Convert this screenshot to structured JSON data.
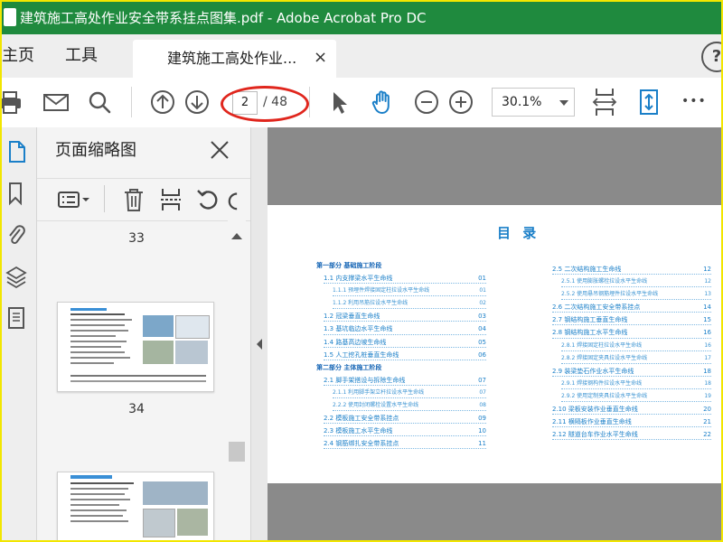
{
  "window": {
    "title": "建筑施工高处作业安全带系挂点图集.pdf - Adobe Acrobat Pro DC"
  },
  "menu": {
    "home": "主页",
    "tools": "工具"
  },
  "tab": {
    "label": "建筑施工高处作业...",
    "close": "×"
  },
  "help": "?",
  "toolbar": {
    "current_page": "2",
    "total_pages": "/ 48",
    "zoom": "30.1%",
    "more": "•••"
  },
  "panel": {
    "title": "页面缩略图",
    "thumbnails": [
      {
        "page": "33"
      },
      {
        "page": "34"
      }
    ]
  },
  "colors": {
    "titlebar": "#1f8a3e",
    "accent_blue": "#1a7fc8",
    "annotation_red": "#e0261d"
  },
  "document": {
    "toc_title": "目  录",
    "left_column": [
      {
        "title": "第一部分 基础施工阶段",
        "page": "",
        "level": "part"
      },
      {
        "title": "1.1 内支撑梁水平生命线",
        "page": "01",
        "level": "item"
      },
      {
        "title": "1.1.1 预埋件焊接固定柱拉设水平生命线",
        "page": "01",
        "level": "sub"
      },
      {
        "title": "1.1.2 利用吊筋拉设水平生命线",
        "page": "02",
        "level": "sub"
      },
      {
        "title": "1.2 冠梁垂直生命线",
        "page": "03",
        "level": "item"
      },
      {
        "title": "1.3 基坑临边水平生命线",
        "page": "04",
        "level": "item"
      },
      {
        "title": "1.4 路基高边坡生命线",
        "page": "05",
        "level": "item"
      },
      {
        "title": "1.5 人工挖孔桩垂直生命线",
        "page": "06",
        "level": "item"
      },
      {
        "title": "第二部分 主体施工阶段",
        "page": "",
        "level": "part"
      },
      {
        "title": "2.1 脚手架搭设与拆除生命线",
        "page": "07",
        "level": "item"
      },
      {
        "title": "2.1.1 利用脚手架立杆拉设水平生命线",
        "page": "07",
        "level": "sub"
      },
      {
        "title": "2.2.2 使用封闭螺栓设置水平生命线",
        "page": "08",
        "level": "sub"
      },
      {
        "title": "2.2 模板施工安全带系挂点",
        "page": "09",
        "level": "item"
      },
      {
        "title": "2.3 模板施工水平生命线",
        "page": "10",
        "level": "item"
      },
      {
        "title": "2.4 钢筋绑扎安全带系挂点",
        "page": "11",
        "level": "item"
      }
    ],
    "right_column": [
      {
        "title": "2.5 二次结构施工生命线",
        "page": "12",
        "level": "item"
      },
      {
        "title": "2.5.1 使用膨胀螺栓拉设水平生命线",
        "page": "12",
        "level": "sub"
      },
      {
        "title": "2.5.2 使用悬吊钢筋埋件拉设水平生命线",
        "page": "13",
        "level": "sub"
      },
      {
        "title": "2.6 二次结构施工安全带系挂点",
        "page": "14",
        "level": "item"
      },
      {
        "title": "2.7 钢结构施工垂直生命线",
        "page": "15",
        "level": "item"
      },
      {
        "title": "2.8 钢结构施工水平生命线",
        "page": "16",
        "level": "item"
      },
      {
        "title": "2.8.1 焊接固定柱拉设水平生命线",
        "page": "16",
        "level": "sub"
      },
      {
        "title": "2.8.2 焊接固定夹具拉设水平生命线",
        "page": "17",
        "level": "sub"
      },
      {
        "title": "2.9 装梁垫石作业水平生命线",
        "page": "18",
        "level": "item"
      },
      {
        "title": "2.9.1 焊接钢构件拉设水平生命线",
        "page": "18",
        "level": "sub"
      },
      {
        "title": "2.9.2 使用定制夹具拉设水平生命线",
        "page": "19",
        "level": "sub"
      },
      {
        "title": "2.10 梁板安装作业垂直生命线",
        "page": "20",
        "level": "item"
      },
      {
        "title": "2.11 横隔板作业垂直生命线",
        "page": "21",
        "level": "item"
      },
      {
        "title": "2.12 隧道台车作业水平生命线",
        "page": "22",
        "level": "item"
      }
    ]
  }
}
